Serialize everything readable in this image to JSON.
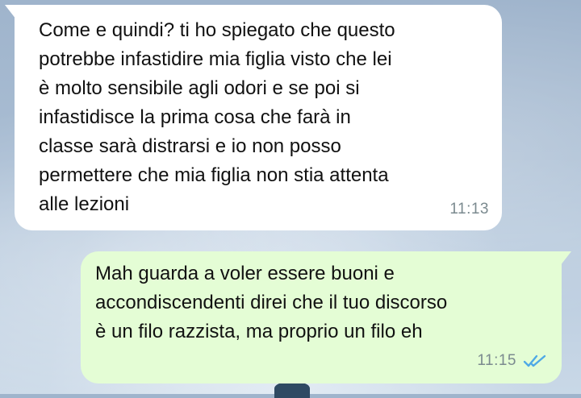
{
  "chat": {
    "incoming": {
      "lines": [
        "Come e quindi? ti ho spiegato che questo",
        "potrebbe infastidire mia figlia visto che lei",
        "è molto sensibile agli odori e se poi si",
        "infastidisce la prima cosa  che farà in",
        "classe sarà distrarsi e io non posso",
        "permettere che mia figlia non stia attenta",
        "alle lezioni"
      ],
      "time": "11:13"
    },
    "outgoing": {
      "lines": [
        "Mah guarda a voler essere buoni e",
        "accondiscendenti direi che il tuo discorso",
        "è un filo razzista, ma proprio un filo eh"
      ],
      "time": "11:15",
      "status_icon": "double-check-read-icon"
    }
  },
  "colors": {
    "incoming_bubble": "#ffffff",
    "outgoing_bubble": "#e4fdd5",
    "read_tick": "#4fa9e6",
    "timestamp": "#7b8a8f"
  }
}
